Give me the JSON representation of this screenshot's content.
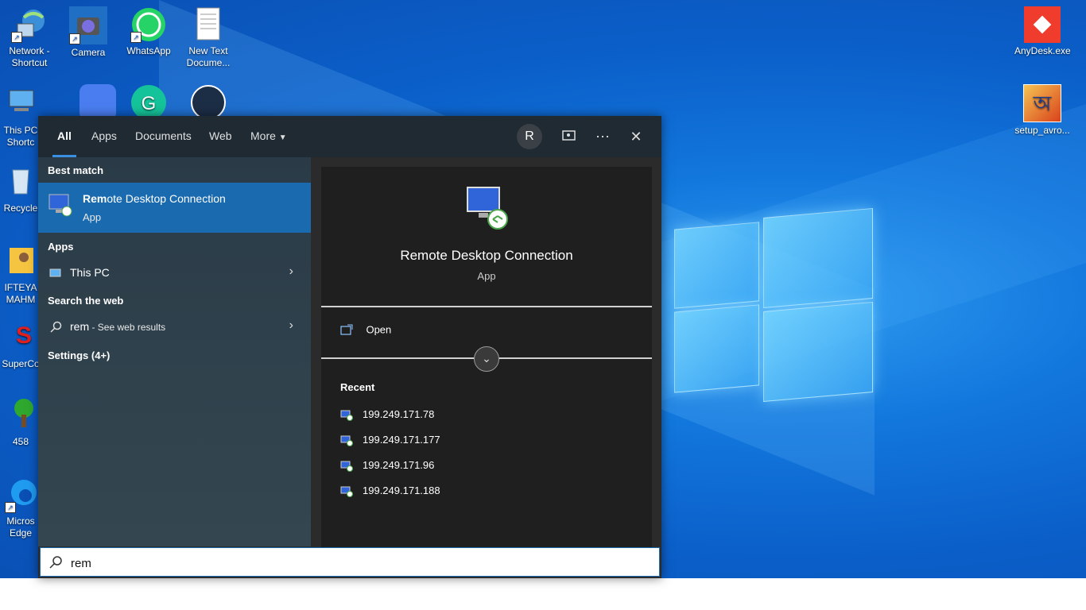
{
  "desktop": {
    "icons": {
      "network": "Network - Shortcut",
      "camera": "Camera",
      "whatsapp": "WhatsApp",
      "new_text": "New Text Docume...",
      "anydesk": "AnyDesk.exe",
      "avro": "setup_avro...",
      "this_pc": "This PC Shortc",
      "recycle": "Recycle",
      "ifteyaz": "IFTEYA MAHM",
      "supercopier": "SuperCo",
      "tree": "458",
      "edge": "Micros Edge"
    }
  },
  "search": {
    "tabs": [
      "All",
      "Apps",
      "Documents",
      "Web",
      "More"
    ],
    "avatar_letter": "R",
    "sections": {
      "best_match": "Best match",
      "apps": "Apps",
      "search_web": "Search the web",
      "settings": "Settings (4+)"
    },
    "best_match": {
      "title_bold": "Rem",
      "title_rest": "ote Desktop Connection",
      "subtitle": "App"
    },
    "apps_item": "This PC",
    "web_item": {
      "query": "rem",
      "suffix": " - See web results"
    },
    "detail": {
      "title": "Remote Desktop Connection",
      "subtitle": "App",
      "open": "Open",
      "recent_header": "Recent",
      "recent": [
        "199.249.171.78",
        "199.249.171.177",
        "199.249.171.96",
        "199.249.171.188"
      ]
    },
    "query": "rem"
  },
  "colors": {
    "accent": "#1a6ab0",
    "selection": "#1a6ab0"
  }
}
